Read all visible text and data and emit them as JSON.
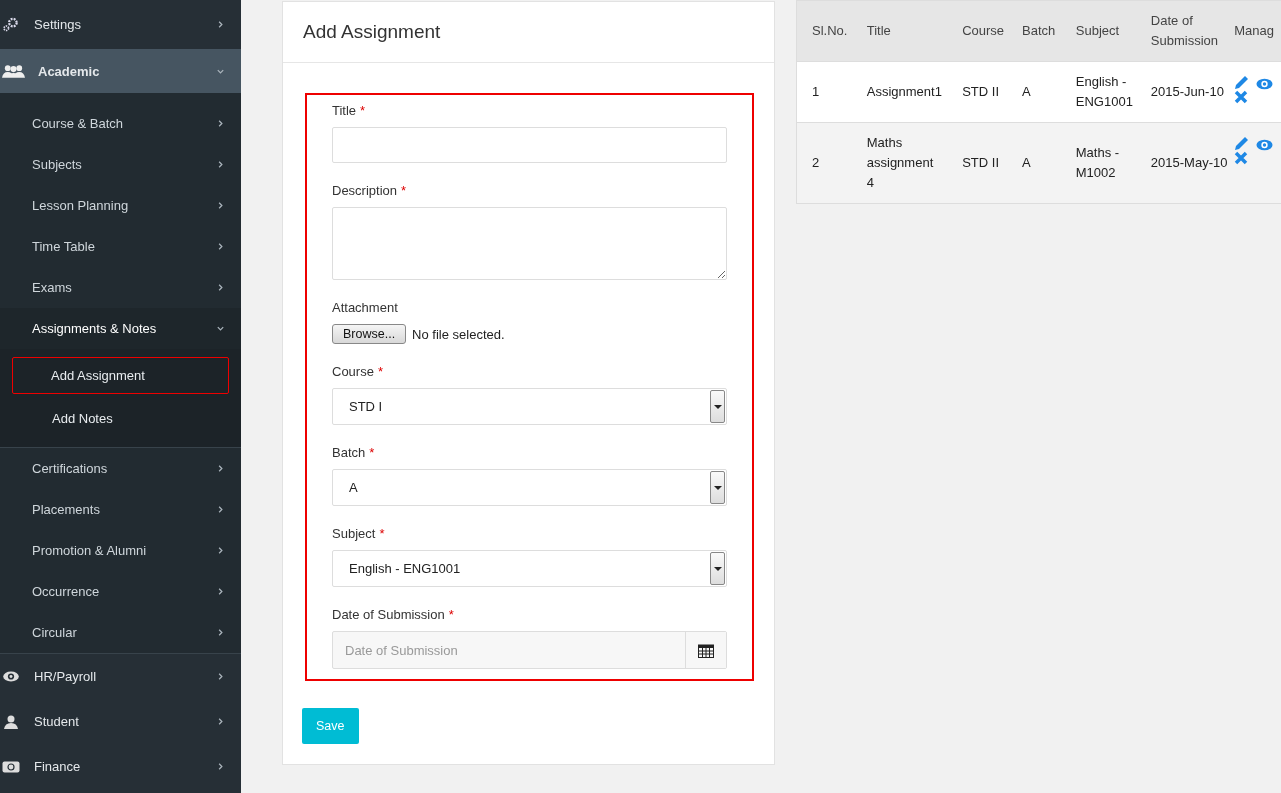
{
  "sidebar": {
    "items": [
      {
        "label": "Settings",
        "expanded": false
      },
      {
        "label": "Academic",
        "expanded": true,
        "children": [
          {
            "label": "Course & Batch",
            "expanded": false
          },
          {
            "label": "Subjects",
            "expanded": false
          },
          {
            "label": "Lesson Planning",
            "expanded": false
          },
          {
            "label": "Time Table",
            "expanded": false
          },
          {
            "label": "Exams",
            "expanded": false
          },
          {
            "label": "Assignments & Notes",
            "expanded": true,
            "children": [
              {
                "label": "Add Assignment",
                "selected": true
              },
              {
                "label": "Add Notes",
                "selected": false
              }
            ]
          },
          {
            "label": "Certifications",
            "expanded": false
          },
          {
            "label": "Placements",
            "expanded": false
          },
          {
            "label": "Promotion & Alumni",
            "expanded": false
          },
          {
            "label": "Occurrence",
            "expanded": false
          },
          {
            "label": "Circular",
            "expanded": false
          }
        ]
      },
      {
        "label": "HR/Payroll",
        "expanded": false
      },
      {
        "label": "Student",
        "expanded": false
      },
      {
        "label": "Finance",
        "expanded": false
      }
    ]
  },
  "form": {
    "title": "Add Assignment",
    "fields": [
      {
        "kind": "text",
        "label": "Title",
        "required": true
      },
      {
        "kind": "textarea",
        "label": "Description",
        "required": true
      },
      {
        "kind": "file",
        "label": "Attachment",
        "required": false,
        "button": "Browse...",
        "status": "No file selected."
      },
      {
        "kind": "select",
        "label": "Course",
        "required": true,
        "value": "STD I"
      },
      {
        "kind": "select",
        "label": "Batch",
        "required": true,
        "value": "A"
      },
      {
        "kind": "select",
        "label": "Subject",
        "required": true,
        "value": "English - ENG1001"
      },
      {
        "kind": "date",
        "label": "Date of Submission",
        "required": true,
        "placeholder": "Date of Submission"
      }
    ],
    "required_mark": "*",
    "save": "Save"
  },
  "table": {
    "columns": [
      "Sl.No.",
      "Title",
      "Course",
      "Batch",
      "Subject",
      "Date of Submission",
      "Manag"
    ],
    "rows": [
      {
        "cells": [
          "1",
          "Assignment1",
          "STD II",
          "A",
          "English - ENG1001",
          "2015-Jun-10"
        ]
      },
      {
        "cells": [
          "2",
          "Maths assignment 4",
          "STD II",
          "A",
          "Maths - M1002",
          "2015-May-10"
        ]
      }
    ]
  }
}
